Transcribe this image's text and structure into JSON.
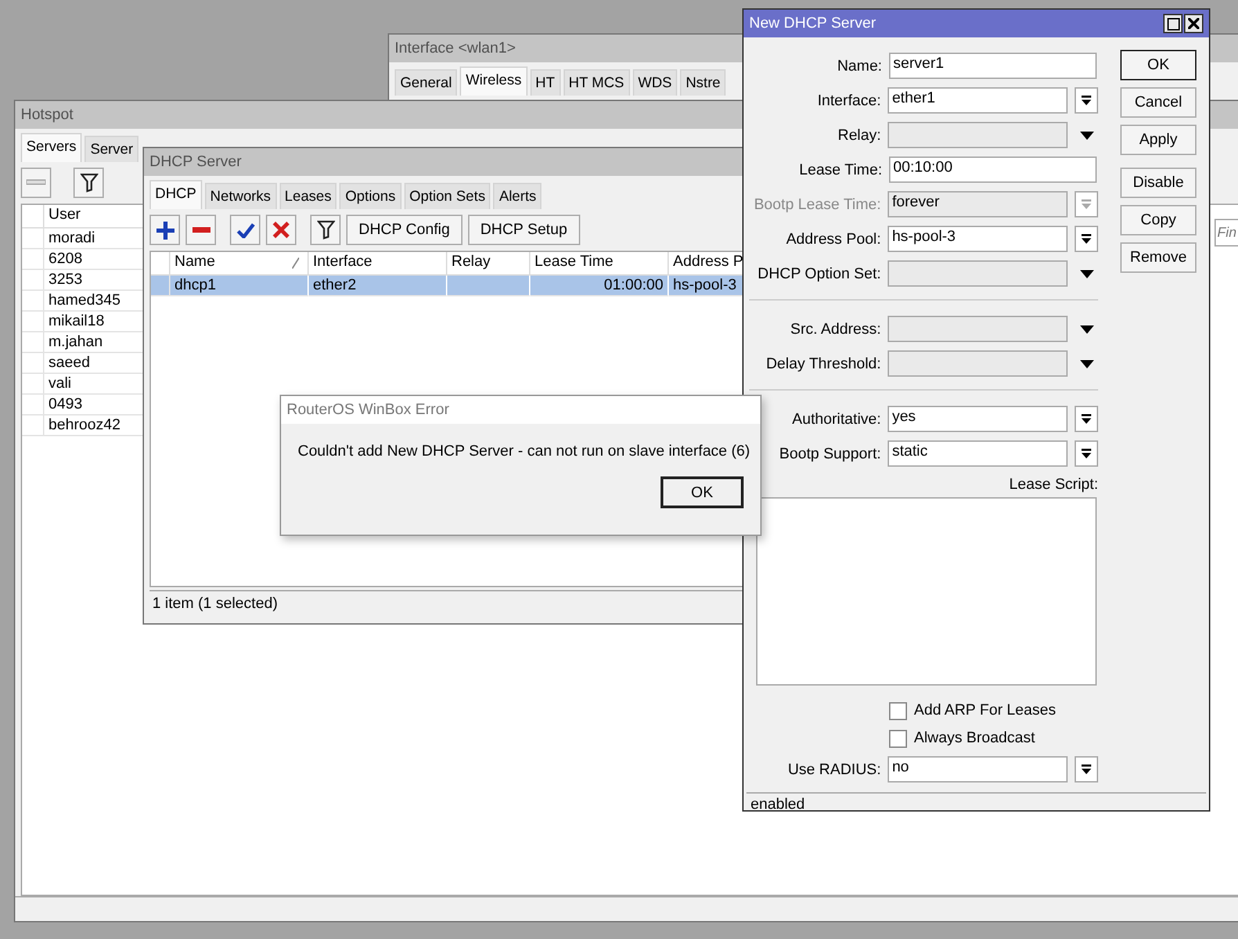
{
  "interface_window": {
    "title": "Interface <wlan1>",
    "tabs": [
      {
        "label": "General",
        "selected": false
      },
      {
        "label": "Wireless",
        "selected": true
      },
      {
        "label": "HT",
        "selected": false
      },
      {
        "label": "HT MCS",
        "selected": false
      },
      {
        "label": "WDS",
        "selected": false
      },
      {
        "label": "Nstre",
        "selected": false
      }
    ]
  },
  "hotspot_window": {
    "title": "Hotspot",
    "tabs": [
      {
        "label": "Servers",
        "selected": true
      },
      {
        "label": "Server",
        "selected": false
      }
    ],
    "find_placeholder": "Fin",
    "table": {
      "columns": [
        "User"
      ],
      "rows": [
        "moradi",
        "6208",
        "3253",
        "hamed345",
        "mikail18",
        "m.jahan",
        "saeed",
        "vali",
        "0493",
        "behrooz42"
      ]
    }
  },
  "dhcp_window": {
    "title": "DHCP Server",
    "tabs": [
      {
        "label": "DHCP",
        "selected": true
      },
      {
        "label": "Networks",
        "selected": false
      },
      {
        "label": "Leases",
        "selected": false
      },
      {
        "label": "Options",
        "selected": false
      },
      {
        "label": "Option Sets",
        "selected": false
      },
      {
        "label": "Alerts",
        "selected": false
      }
    ],
    "toolbar_buttons": [
      "DHCP Config",
      "DHCP Setup"
    ],
    "table": {
      "columns": [
        "Name",
        "Interface",
        "Relay",
        "Lease Time",
        "Address P"
      ],
      "rows": [
        {
          "cells": [
            "dhcp1",
            "ether2",
            "",
            "01:00:00",
            "hs-pool-3"
          ],
          "selected": true
        }
      ]
    },
    "status": "1 item (1 selected)"
  },
  "error_dialog": {
    "title": "RouterOS WinBox Error",
    "message": "Couldn't add New DHCP Server - can not run on slave interface (6)",
    "button": "OK"
  },
  "new_dhcp_window": {
    "title": "New DHCP Server",
    "fields": [
      {
        "label": "Name:",
        "value": "server1",
        "kind": "text",
        "disabled": false
      },
      {
        "label": "Interface:",
        "value": "ether1",
        "kind": "select",
        "disabled": false
      },
      {
        "label": "Relay:",
        "kind": "combo",
        "disabled": false
      },
      {
        "label": "Lease Time:",
        "value": "00:10:00",
        "kind": "text",
        "disabled": false
      },
      {
        "label": "Bootp Lease Time:",
        "value": "forever",
        "kind": "select",
        "disabled": true
      },
      {
        "label": "Address Pool:",
        "value": "hs-pool-3",
        "kind": "select",
        "disabled": false
      },
      {
        "label": "DHCP Option Set:",
        "kind": "combo",
        "disabled": false
      },
      {
        "kind": "separator"
      },
      {
        "label": "Src. Address:",
        "kind": "combo",
        "disabled": false
      },
      {
        "label": "Delay Threshold:",
        "kind": "combo",
        "disabled": false
      },
      {
        "kind": "separator"
      },
      {
        "label": "Authoritative:",
        "value": "yes",
        "kind": "select",
        "disabled": false
      },
      {
        "label": "Bootp Support:",
        "value": "static",
        "kind": "select",
        "disabled": false
      }
    ],
    "lease_script_label": "Lease Script:",
    "checkboxes": [
      {
        "label": "Add ARP For Leases",
        "checked": false
      },
      {
        "label": "Always Broadcast",
        "checked": false
      }
    ],
    "radius": {
      "label": "Use RADIUS:",
      "value": "no"
    },
    "buttons": [
      {
        "label": "OK",
        "default": true
      },
      {
        "label": "Cancel",
        "default": false
      },
      {
        "label": "Apply",
        "default": false
      },
      {
        "label": "Disable",
        "default": false
      },
      {
        "label": "Copy",
        "default": false
      },
      {
        "label": "Remove",
        "default": false
      }
    ],
    "status": "enabled"
  }
}
